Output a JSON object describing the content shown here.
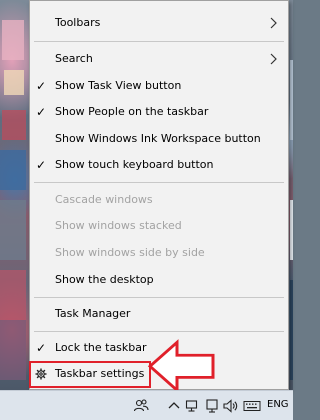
{
  "context_menu": {
    "items": [
      {
        "label": "Toolbars",
        "checked": false,
        "disabled": false,
        "submenu": true
      },
      {
        "label": "Search",
        "checked": false,
        "disabled": false,
        "submenu": true
      },
      {
        "label": "Show Task View button",
        "checked": true,
        "disabled": false,
        "submenu": false
      },
      {
        "label": "Show People on the taskbar",
        "checked": true,
        "disabled": false,
        "submenu": false
      },
      {
        "label": "Show Windows Ink Workspace button",
        "checked": false,
        "disabled": false,
        "submenu": false
      },
      {
        "label": "Show touch keyboard button",
        "checked": true,
        "disabled": false,
        "submenu": false
      },
      {
        "label": "Cascade windows",
        "checked": false,
        "disabled": true,
        "submenu": false
      },
      {
        "label": "Show windows stacked",
        "checked": false,
        "disabled": true,
        "submenu": false
      },
      {
        "label": "Show windows side by side",
        "checked": false,
        "disabled": true,
        "submenu": false
      },
      {
        "label": "Show the desktop",
        "checked": false,
        "disabled": false,
        "submenu": false
      },
      {
        "label": "Task Manager",
        "checked": false,
        "disabled": false,
        "submenu": false
      },
      {
        "label": "Lock the taskbar",
        "checked": true,
        "disabled": false,
        "submenu": false
      },
      {
        "label": "Taskbar settings",
        "checked": false,
        "disabled": false,
        "submenu": false,
        "icon": "gear-icon"
      }
    ],
    "check_glyph": "✓"
  },
  "annotation": {
    "highlighted_item": "Taskbar settings",
    "color": "#e0202a"
  },
  "taskbar": {
    "tray_icons": [
      "people-icon",
      "chevron-up-icon",
      "network-icon",
      "volume-icon",
      "keyboard-icon"
    ],
    "language": "ENG"
  },
  "colors": {
    "menu_bg": "#f2f2f2",
    "disabled_text": "#a3a3a3",
    "taskbar_bg": "#dde4ec"
  }
}
